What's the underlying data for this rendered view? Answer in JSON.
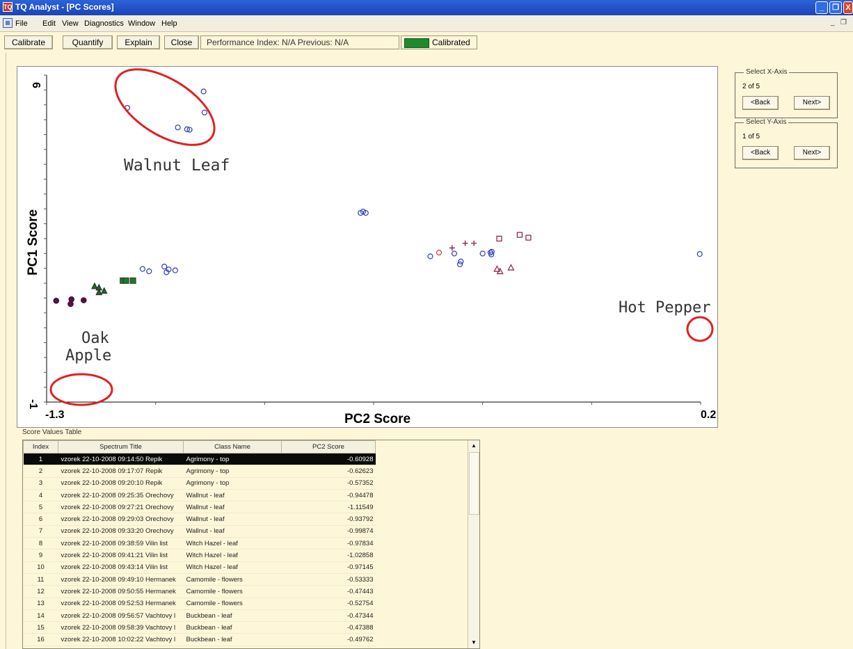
{
  "window": {
    "title": "TQ Analyst  - [PC Scores]",
    "app_icon": "tq-analyst-app-icon",
    "controls": [
      "_",
      "❐",
      "X"
    ]
  },
  "menu": {
    "items": [
      "File",
      "Edit",
      "View",
      "Diagnostics",
      "Window",
      "Help"
    ],
    "mdi_controls": [
      "_",
      "❐"
    ]
  },
  "toolbar": {
    "calibrate": "Calibrate",
    "quantify": "Quantify",
    "explain": "Explain",
    "close": "Close",
    "performance": "Performance Index:  N/A   Previous:  N/A",
    "status": "Calibrated",
    "status_color": "#1e8a2a"
  },
  "axis_selectors": {
    "x": {
      "title": "Select X-Axis",
      "position": "2 of 5",
      "back": "<Back",
      "next": "Next>"
    },
    "y": {
      "title": "Select Y-Axis",
      "position": "1 of 5",
      "back": "<Back",
      "next": "Next>"
    }
  },
  "chart_data": {
    "type": "scatter",
    "xlabel": "PC2 Score",
    "ylabel": "PC1 Score",
    "x_tick_labels": [
      "-1.3",
      "0.2"
    ],
    "y_tick_labels": [
      "6",
      "-1"
    ],
    "xlim": [
      -1.3,
      0.2
    ],
    "ylim": [
      -1,
      6
    ],
    "annotations": [
      "Walnut Leaf",
      "Oak Apple",
      "Hot Pepper"
    ],
    "circled_groups": [
      "Walnut Leaf",
      "Oak Apple",
      "Hot Pepper"
    ],
    "highlight_color": "#e02020",
    "series": [
      {
        "marker": "circle-open",
        "color": "#2b3fc0",
        "points": [
          [
            -0.94,
            5.65
          ],
          [
            -1.115,
            5.3
          ],
          [
            -0.938,
            5.2
          ],
          [
            -0.999,
            4.88
          ],
          [
            -0.978,
            4.84
          ],
          [
            -0.972,
            4.83
          ],
          [
            -0.58,
            3.05
          ],
          [
            -0.574,
            3.08
          ],
          [
            -0.568,
            3.05
          ],
          [
            -1.08,
            1.85
          ],
          [
            -1.065,
            1.8
          ],
          [
            -1.03,
            1.9
          ],
          [
            -1.025,
            1.78
          ],
          [
            -1.02,
            1.84
          ],
          [
            -1.005,
            1.82
          ],
          [
            -0.42,
            2.12
          ],
          [
            -0.365,
            2.18
          ],
          [
            -0.35,
            2.01
          ],
          [
            -0.352,
            1.95
          ],
          [
            -0.3,
            2.18
          ],
          [
            -0.282,
            2.2
          ],
          [
            -0.279,
            2.22
          ],
          [
            -0.28,
            2.16
          ],
          [
            0.198,
            2.17
          ]
        ]
      },
      {
        "marker": "circle-open",
        "color": "#e03030",
        "points": [
          [
            -0.4,
            2.2
          ]
        ]
      },
      {
        "marker": "plus",
        "color": "#8a1c3a",
        "points": [
          [
            -0.37,
            2.3
          ],
          [
            -0.34,
            2.4
          ],
          [
            -0.32,
            2.4
          ]
        ]
      },
      {
        "marker": "square-open",
        "color": "#8a1c3a",
        "points": [
          [
            -0.262,
            2.5
          ],
          [
            -0.215,
            2.58
          ],
          [
            -0.195,
            2.52
          ]
        ]
      },
      {
        "marker": "triangle-open",
        "color": "#8a1c3a",
        "points": [
          [
            -0.267,
            1.85
          ],
          [
            -0.26,
            1.8
          ],
          [
            -0.235,
            1.88
          ]
        ]
      },
      {
        "marker": "triangle-filled",
        "color": "#1e6b2c",
        "points": [
          [
            -1.19,
            1.48
          ],
          [
            -1.18,
            1.45
          ],
          [
            -1.18,
            1.35
          ],
          [
            -1.168,
            1.38
          ]
        ]
      },
      {
        "marker": "square-filled",
        "color": "#1e7a2a",
        "points": [
          [
            -1.125,
            1.6
          ],
          [
            -1.118,
            1.6
          ],
          [
            -1.102,
            1.6
          ]
        ]
      },
      {
        "marker": "circle-filled",
        "color": "#5a1040",
        "points": [
          [
            -1.278,
            1.17
          ],
          [
            -1.243,
            1.2
          ],
          [
            -1.245,
            1.1
          ],
          [
            -1.215,
            1.18
          ]
        ]
      }
    ]
  },
  "score_table": {
    "caption": "Score Values Table",
    "columns": [
      "Index",
      "Spectrum Title",
      "Class Name",
      "PC2 Score"
    ],
    "selected_row": 0,
    "rows": [
      [
        "1",
        "vzorek 22-10-2008 09:14:50 Repik",
        "Agrimony - top",
        "-0.60928"
      ],
      [
        "2",
        "vzorek 22-10-2008 09:17:07 Repik",
        "Agrimony - top",
        "-0.62623"
      ],
      [
        "3",
        "vzorek 22-10-2008 09:20:10 Repik",
        "Agrimony - top",
        "-0.57352"
      ],
      [
        "4",
        "vzorek 22-10-2008 09:25:35 Orechovy",
        "Wallnut - leaf",
        "-0.94478"
      ],
      [
        "5",
        "vzorek 22-10-2008 09:27:21 Orechovy",
        "Wallnut - leaf",
        "-1.11549"
      ],
      [
        "6",
        "vzorek 22-10-2008 09:29:03 Orechovy",
        "Wallnut - leaf",
        "-0.93792"
      ],
      [
        "7",
        "vzorek 22-10-2008 09:33:20 Orechovy",
        "Wallnut - leaf",
        "-0.99874"
      ],
      [
        "8",
        "vzorek 22-10-2008 09:38:59 Vilin list",
        "Witch Hazel - leaf",
        "-0.97834"
      ],
      [
        "9",
        "vzorek 22-10-2008 09:41:21 Vilin list",
        "Witch Hazel - leaf",
        "-1.02858"
      ],
      [
        "10",
        "vzorek 22-10-2008 09:43:14 Vilin list",
        "Witch Hazel - leaf",
        "-0.97145"
      ],
      [
        "11",
        "vzorek 22-10-2008 09:49:10 Hermanek",
        "Camomile - flowers",
        "-0.53333"
      ],
      [
        "12",
        "vzorek 22-10-2008 09:50:55 Hermanek",
        "Camomile - flowers",
        "-0.47443"
      ],
      [
        "13",
        "vzorek 22-10-2008 09:52:53 Hermanek",
        "Camomile - flowers",
        "-0.52754"
      ],
      [
        "14",
        "vzorek 22-10-2008 09:56:57 Vachtovy l",
        "Buckbean - leaf",
        "-0.47344"
      ],
      [
        "15",
        "vzorek 22-10-2008 09:58:39 Vachtovy l",
        "Buckbean - leaf",
        "-0.47388"
      ],
      [
        "16",
        "vzorek 22-10-2008 10:02:22 Vachtovy l",
        "Buckbean - leaf",
        "-0.49762"
      ]
    ]
  }
}
